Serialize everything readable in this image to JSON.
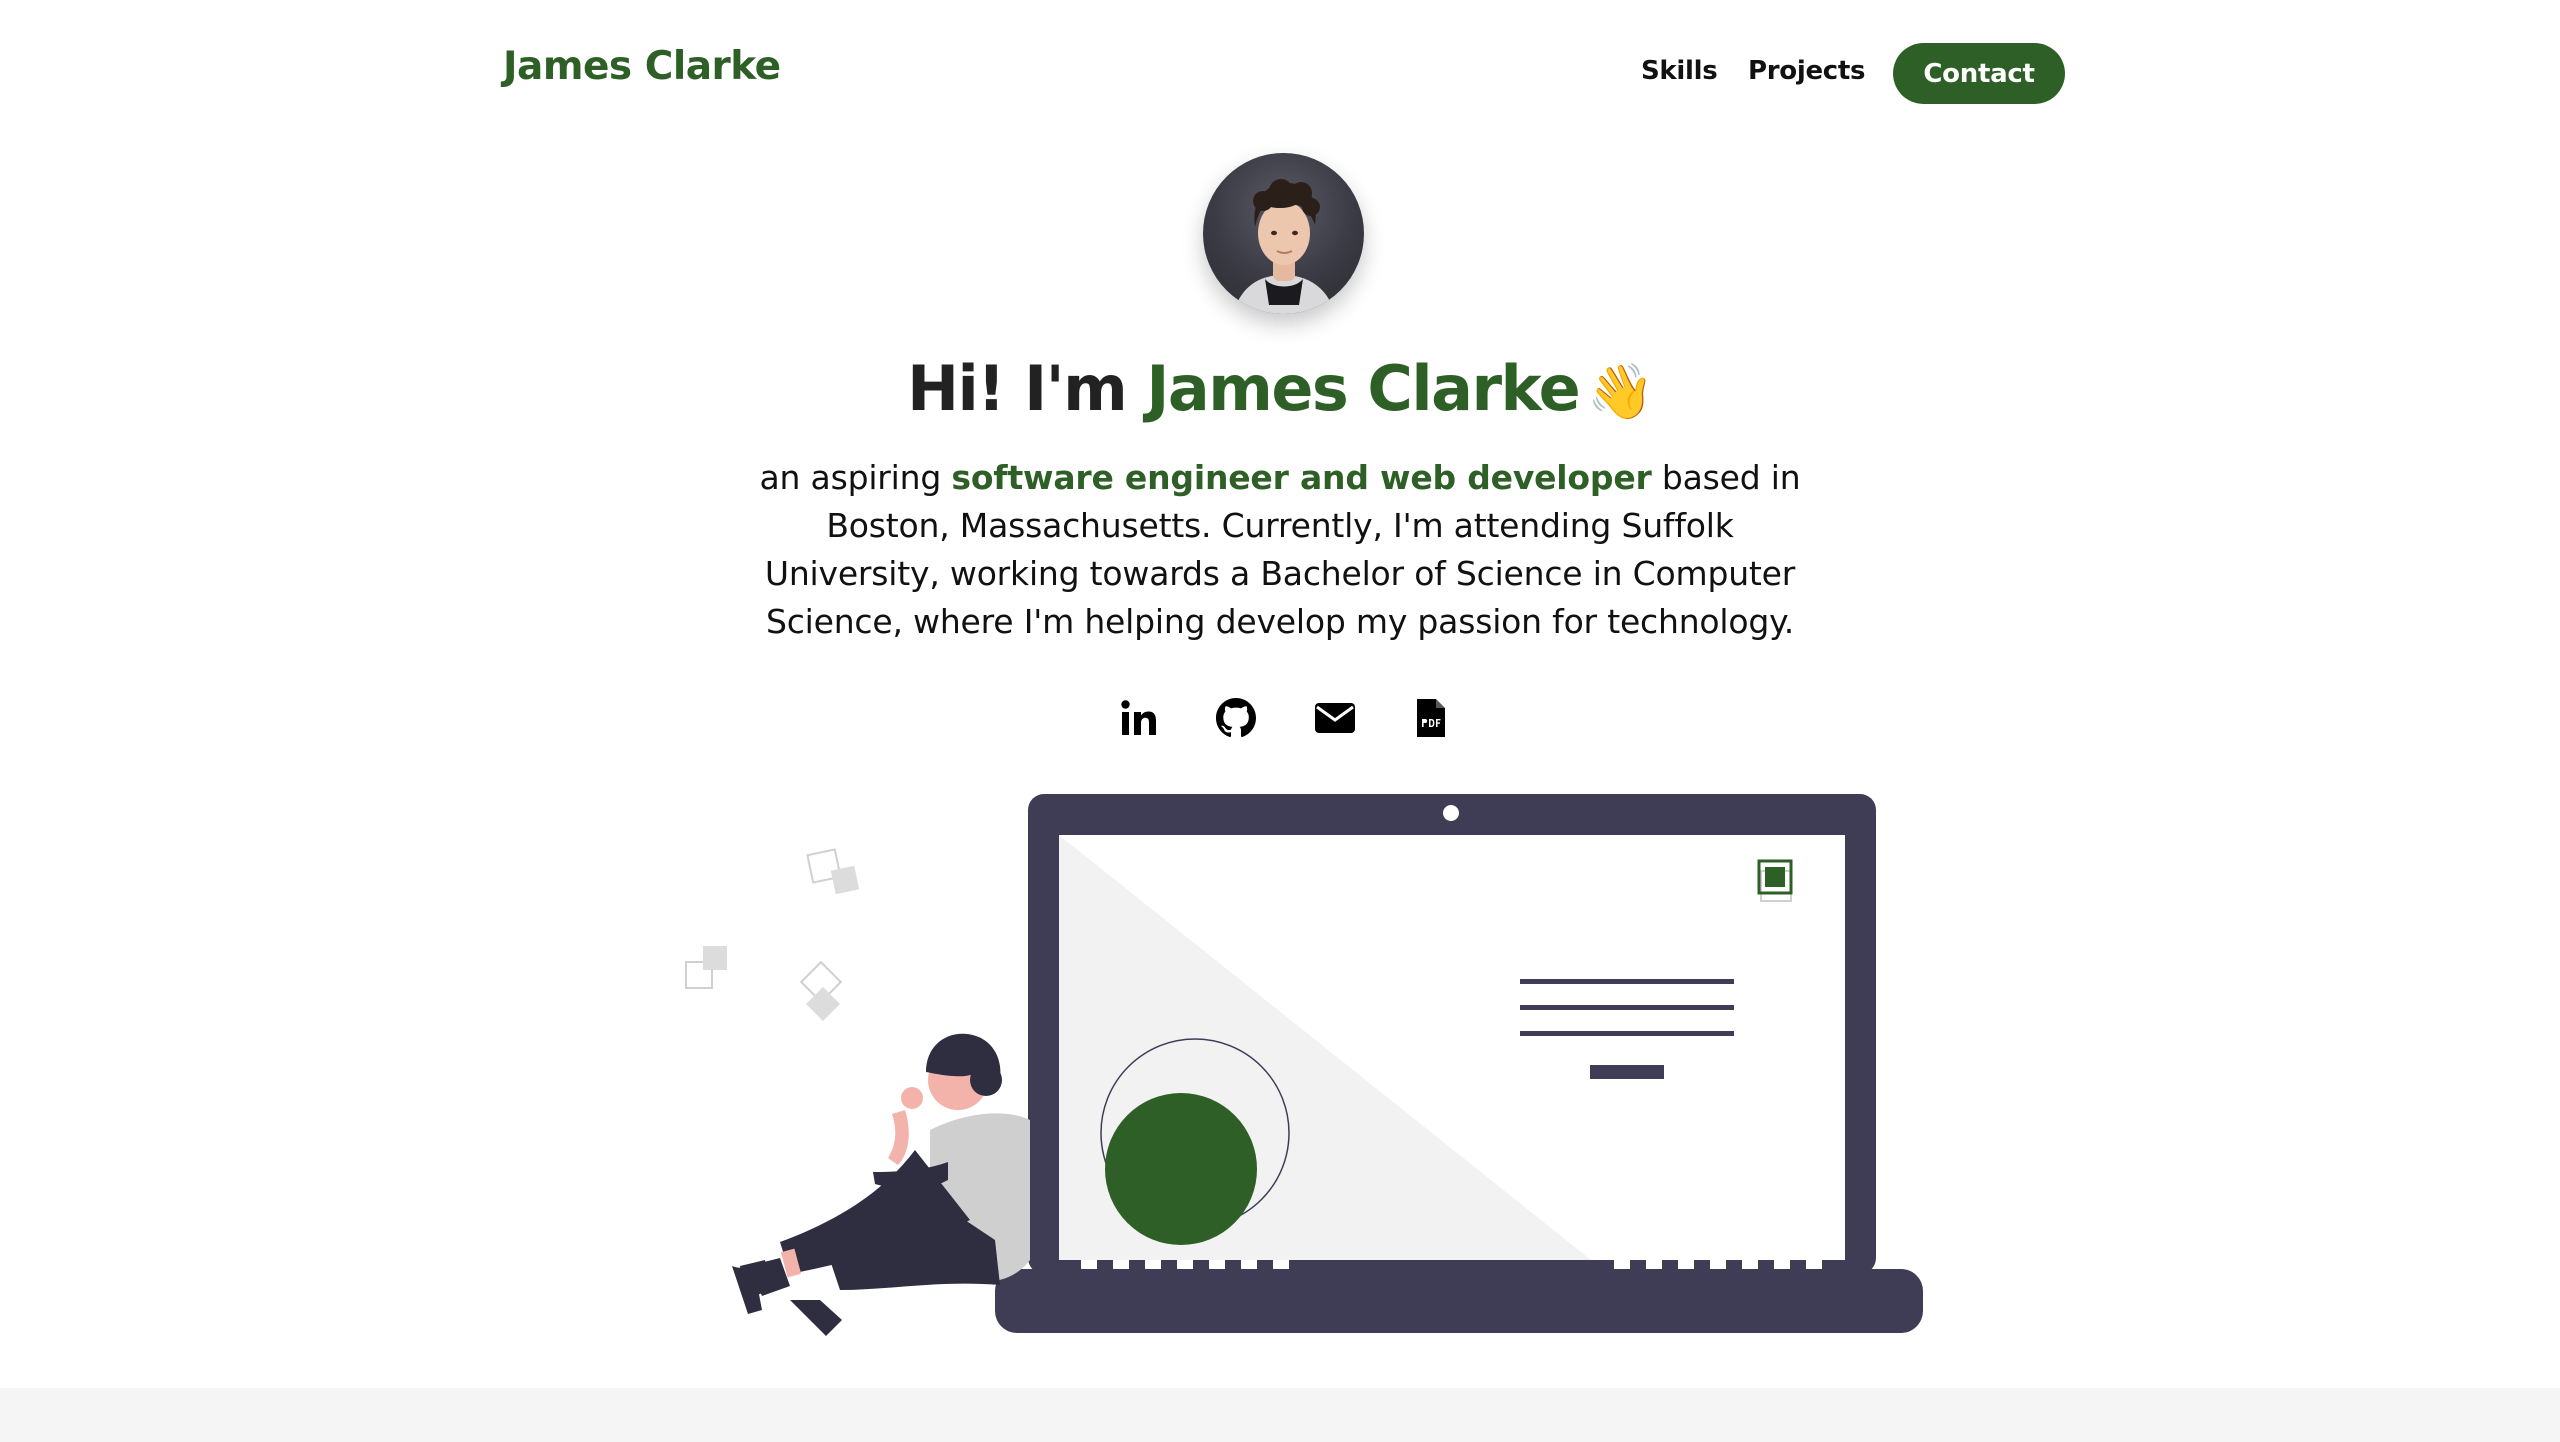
{
  "nav": {
    "brand": "James Clarke",
    "links": [
      {
        "label": "Skills"
      },
      {
        "label": "Projects"
      }
    ],
    "contact_label": "Contact"
  },
  "hero": {
    "greeting": "Hi! I'm",
    "name": "James Clarke",
    "wave": "👋",
    "intro_before": "an aspiring",
    "intro_emphasis": "software engineer and web developer",
    "intro_after": "based in Boston, Massachusetts. Currently, I'm attending Suffolk University, working towards a Bachelor of Science in Computer Science, where I'm helping develop my passion for technology."
  },
  "social": [
    {
      "icon": "linkedin-icon"
    },
    {
      "icon": "github-icon"
    },
    {
      "icon": "email-icon"
    },
    {
      "icon": "pdf-resume-icon"
    }
  ],
  "colors": {
    "accent": "#2e5f26",
    "dark": "#3f3d56",
    "light_gray": "#f2f2f2"
  }
}
